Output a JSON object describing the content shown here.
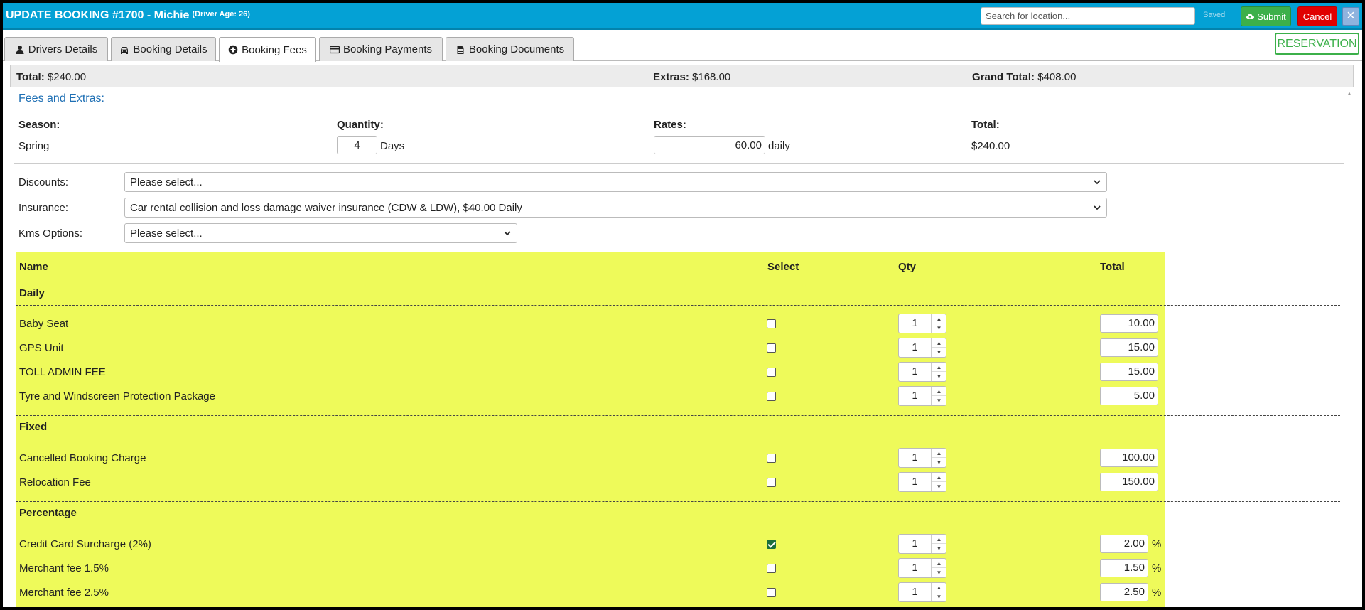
{
  "header": {
    "title": "UPDATE BOOKING #1700 - Michie",
    "driver_age": "(Driver Age: 26)",
    "search_placeholder": "Search for location...",
    "saved": "Saved",
    "submit": "Submit",
    "cancel": "Cancel",
    "close": "×",
    "colors": {
      "bar": "#04a1d5",
      "submit": "#3cb04a",
      "cancel": "#e00000"
    }
  },
  "tabs": [
    {
      "label": "Drivers Details",
      "icon": "user-icon"
    },
    {
      "label": "Booking Details",
      "icon": "car-icon"
    },
    {
      "label": "Booking Fees",
      "icon": "plus-circle-icon",
      "active": true
    },
    {
      "label": "Booking Payments",
      "icon": "credit-card-icon"
    },
    {
      "label": "Booking Documents",
      "icon": "file-icon"
    }
  ],
  "reservation": "RESERVATION",
  "totals": {
    "total_label": "Total:",
    "total_value": "$240.00",
    "extras_label": "Extras:",
    "extras_value": "$168.00",
    "grand_label": "Grand Total:",
    "grand_value": "$408.00"
  },
  "fees": {
    "title": "Fees and Extras:",
    "season_label": "Season:",
    "season_value": "Spring",
    "quantity_label": "Quantity:",
    "quantity_value": "4",
    "quantity_unit": "Days",
    "rates_label": "Rates:",
    "rates_value": "60.00",
    "rates_unit": "daily",
    "total_label": "Total:",
    "total_value": "$240.00"
  },
  "options": {
    "discounts_label": "Discounts:",
    "discounts_value": "Please select...",
    "insurance_label": "Insurance:",
    "insurance_value": "Car rental collision and loss damage waiver insurance (CDW & LDW), $40.00 Daily",
    "kms_label": "Kms Options:",
    "kms_value": "Please select..."
  },
  "extras": {
    "headers": {
      "name": "Name",
      "select": "Select",
      "qty": "Qty",
      "total": "Total"
    },
    "groups": {
      "daily": "Daily",
      "fixed": "Fixed",
      "percentage": "Percentage"
    },
    "rows": [
      {
        "name": "Baby Seat",
        "checked": false,
        "qty": "1",
        "total": "10.00"
      },
      {
        "name": "GPS Unit",
        "checked": false,
        "qty": "1",
        "total": "15.00"
      },
      {
        "name": "TOLL ADMIN FEE",
        "checked": false,
        "qty": "1",
        "total": "15.00"
      },
      {
        "name": "Tyre and Windscreen Protection Package",
        "checked": false,
        "qty": "1",
        "total": "5.00"
      },
      {
        "name": "Cancelled Booking Charge",
        "checked": false,
        "qty": "1",
        "total": "100.00"
      },
      {
        "name": "Relocation Fee",
        "checked": false,
        "qty": "1",
        "total": "150.00"
      },
      {
        "name": "Credit Card Surcharge (2%)",
        "checked": true,
        "qty": "1",
        "total": "2.00"
      },
      {
        "name": "Merchant fee 1.5%",
        "checked": false,
        "qty": "1",
        "total": "1.50"
      },
      {
        "name": "Merchant fee 2.5%",
        "checked": false,
        "qty": "1",
        "total": "2.50"
      }
    ],
    "percent_sign": "%",
    "highlight_color": "#eefa5a"
  }
}
